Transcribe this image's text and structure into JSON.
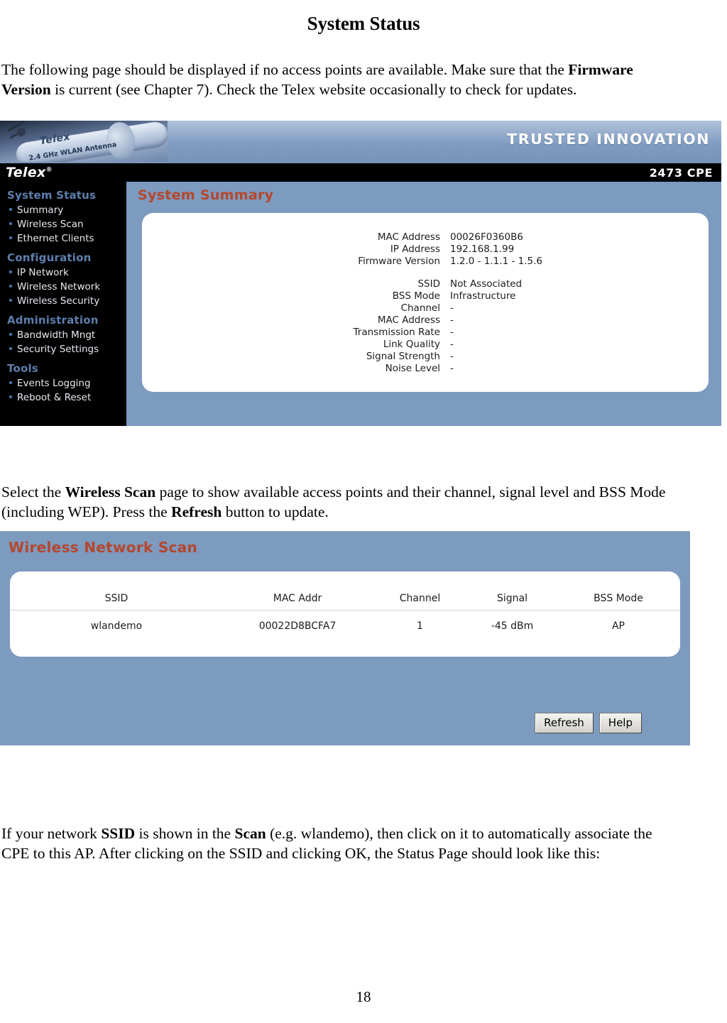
{
  "document": {
    "title": "System Status",
    "page_number": "18",
    "paragraphs": {
      "intro": {
        "part1": "The following page should be displayed if no access points are available. Make sure that the ",
        "bold1": "Firmware Version",
        "part2": " is current (see Chapter 7).  Check the Telex website occasionally to check for updates."
      },
      "scan": {
        "part1": "Select the ",
        "bold1": "Wireless Scan",
        "part2": " page to show available access points and their channel, signal level and BSS Mode (including WEP).  Press the ",
        "bold2": "Refresh",
        "part3": " button to update."
      },
      "ssid": {
        "part1": "If your network ",
        "bold1": "SSID",
        "part2": " is shown in the ",
        "bold2": "Scan",
        "part3": "  (e.g. wlandemo), then click on it to automatically associate the CPE to this AP.  After clicking on the SSID and clicking OK, the Status Page should look like this:"
      }
    }
  },
  "screenshot_summary": {
    "masthead": {
      "tagline": "TRUSTED INNOVATION",
      "antenna_brand": "Telex",
      "antenna_caption": "2.4 GHz WLAN Antenna"
    },
    "brandbar": {
      "logo": "Telex",
      "logo_mark": "®",
      "model": "2473 CPE"
    },
    "sidebar": {
      "groups": [
        {
          "heading": "System Status",
          "items": [
            "Summary",
            "Wireless Scan",
            "Ethernet Clients"
          ]
        },
        {
          "heading": "Configuration",
          "items": [
            "IP Network",
            "Wireless Network",
            "Wireless Security"
          ]
        },
        {
          "heading": "Administration",
          "items": [
            "Bandwidth Mngt",
            "Security Settings"
          ]
        },
        {
          "heading": "Tools",
          "items": [
            "Events Logging",
            "Reboot & Reset"
          ]
        }
      ]
    },
    "panel": {
      "heading": "System Summary",
      "device_info": [
        {
          "key": "MAC Address",
          "value": "00026F0360B6"
        },
        {
          "key": "IP Address",
          "value": "192.168.1.99"
        },
        {
          "key": "Firmware Version",
          "value": "1.2.0 - 1.1.1 - 1.5.6"
        }
      ],
      "link_info": [
        {
          "key": "SSID",
          "value": "Not Associated"
        },
        {
          "key": "BSS Mode",
          "value": "Infrastructure"
        },
        {
          "key": "Channel",
          "value": "-"
        },
        {
          "key": "MAC Address",
          "value": "-"
        },
        {
          "key": "Transmission Rate",
          "value": "-"
        },
        {
          "key": "Link Quality",
          "value": "-"
        },
        {
          "key": "Signal Strength",
          "value": "-"
        },
        {
          "key": "Noise Level",
          "value": "-"
        }
      ]
    },
    "colors": {
      "page_background": "#7d9abf",
      "heading": "#b4472c",
      "nav_heading": "#5d7fae",
      "nav_bullet": "#4f7bb5",
      "brandbar": "#000000"
    }
  },
  "screenshot_scan": {
    "panel": {
      "heading": "Wireless Network Scan"
    },
    "table": {
      "columns": [
        "SSID",
        "MAC Addr",
        "Channel",
        "Signal",
        "BSS Mode"
      ],
      "rows": [
        {
          "ssid": "wlandemo",
          "mac": "00022D8BCFA7",
          "channel": "1",
          "signal": "-45 dBm",
          "bss_mode": "AP"
        }
      ]
    },
    "buttons": {
      "refresh": "Refresh",
      "help": "Help"
    }
  }
}
